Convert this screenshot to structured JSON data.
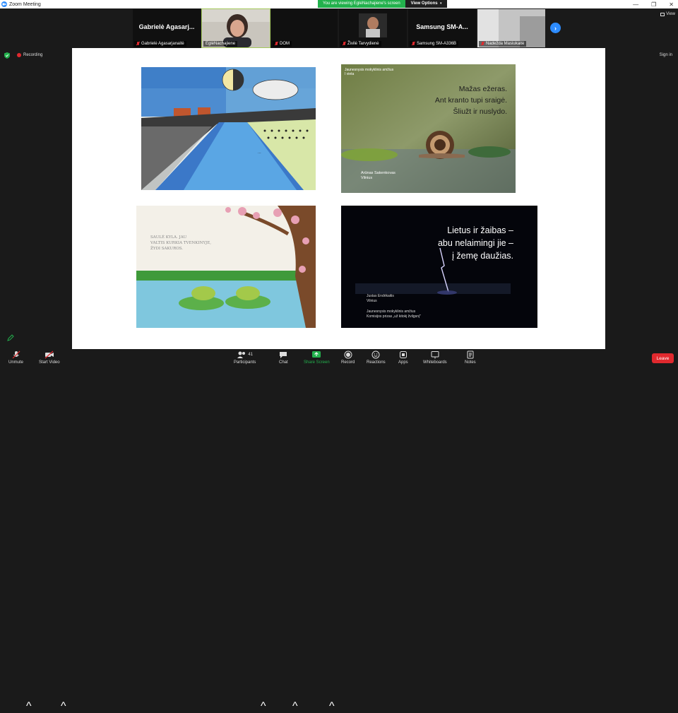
{
  "window": {
    "title": "Zoom Meeting",
    "controls": {
      "minimize": "—",
      "restore": "❐",
      "close": "✕"
    }
  },
  "banner": {
    "viewing_text": "You are viewing EglėNachajiene's screen",
    "view_options_label": "View Options"
  },
  "participants_strip": [
    {
      "big_name": "Gabrielė  Agasarj...",
      "label": "Gabrielė Agasarjanaitė",
      "muted": true,
      "video": false
    },
    {
      "big_name": "",
      "label": "EglėNachajiene",
      "muted": false,
      "video": true,
      "active": true
    },
    {
      "big_name": "",
      "label": "DOM",
      "muted": true,
      "video": false
    },
    {
      "big_name": "",
      "label": "Živilė Tarvydienė",
      "muted": true,
      "video": true
    },
    {
      "big_name": "Samsung  SM-A...",
      "label": "Samsung SM-A336B",
      "muted": true,
      "video": false
    },
    {
      "big_name": "",
      "label": "Nadežda Masiukaitė",
      "muted": true,
      "video": true
    }
  ],
  "view_label": "View",
  "status": {
    "recording_label": "Recording",
    "signin_label": "Sign in"
  },
  "shared": {
    "pic2": {
      "small_caption": [
        "Jaunesnysis mokyklinis amžius",
        "I vieta"
      ],
      "haiku": [
        "Mažas ežeras.",
        "Ant kranto tupi sraigė.",
        "Šliužt ir nuslydo."
      ],
      "author": [
        "Arūnas Sakenkovas",
        "Vilnius"
      ]
    },
    "pic3": {
      "poem": [
        "SAULĖ KYLA. JAU",
        "VALTIS KURKIA TVENKINYJE,",
        "ŽYDI SAKUROS."
      ]
    },
    "pic4": {
      "haiku": [
        "Lietus ir žaibas –",
        "abu nelaimingi jie –",
        "į žemę daužias."
      ],
      "author": [
        "Justas Endrikaitis",
        "Vilnius"
      ],
      "award": [
        "Jaunesnysis mokyklinis amžius",
        "Komisijos prizas „už kitokį žvilgsnį\""
      ]
    }
  },
  "toolbar": {
    "unmute": "Unmute",
    "start_video": "Start Video",
    "participants": "Participants",
    "participants_count": "41",
    "chat": "Chat",
    "share_screen": "Share Screen",
    "record": "Record",
    "reactions": "Reactions",
    "apps": "Apps",
    "whiteboards": "Whiteboards",
    "notes": "Notes",
    "leave": "Leave"
  },
  "colors": {
    "accent_blue": "#2d8cff",
    "share_green": "#23b14d",
    "leave_red": "#e0292e",
    "toolbar_bg": "#1a1a1a"
  }
}
